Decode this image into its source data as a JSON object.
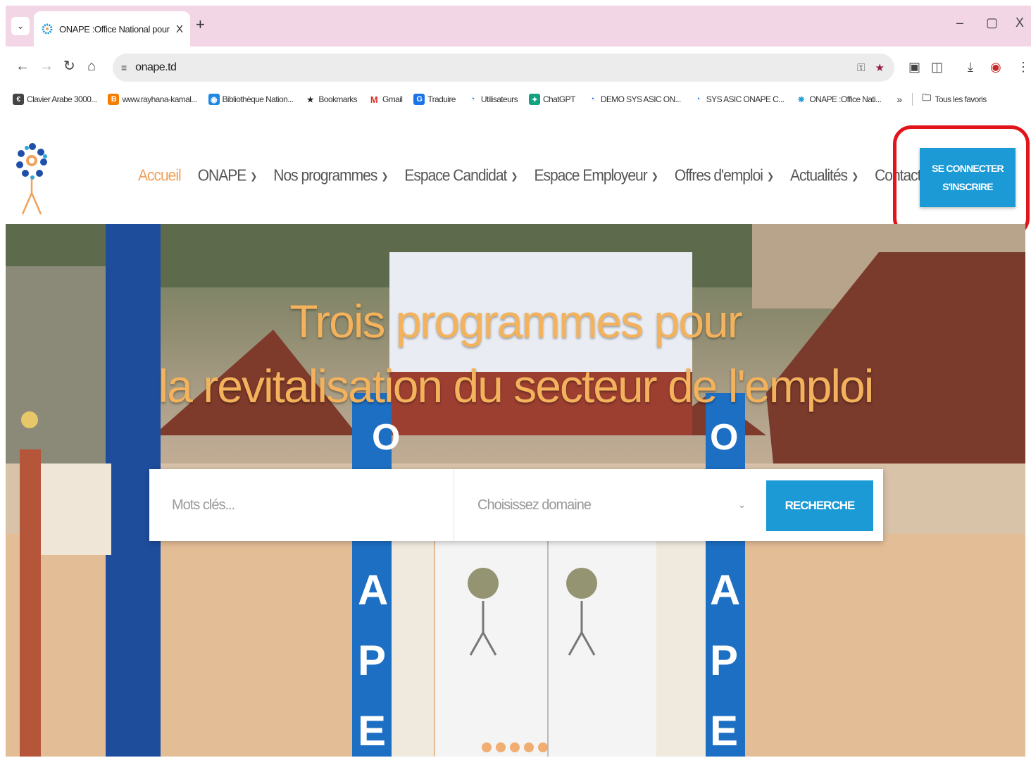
{
  "browser": {
    "tab": {
      "title": "ONAPE :Office National pour l",
      "close": "X"
    },
    "new_tab": "+",
    "window_controls": {
      "minimize": "–",
      "restore": "▢",
      "close": "X"
    },
    "address": {
      "url": "onape.td"
    },
    "bookmarks": [
      {
        "label": "Clavier Arabe 3000...",
        "icon": "keyboard-icon",
        "color": "#444444"
      },
      {
        "label": "www.rayhana-kamal...",
        "icon": "blogger-icon",
        "color": "#f57d00"
      },
      {
        "label": "Bibliothèque Nation...",
        "icon": "library-icon",
        "color": "#1e88e5"
      },
      {
        "label": "Bookmarks",
        "icon": "star-icon",
        "color": "#222222"
      },
      {
        "label": "Gmail",
        "icon": "gmail-icon",
        "color": "#d93025"
      },
      {
        "label": "Traduire",
        "icon": "translate-icon",
        "color": "#1a73e8"
      },
      {
        "label": "Utilisateurs",
        "icon": "globe-icon",
        "color": "#1a73e8"
      },
      {
        "label": "ChatGPT",
        "icon": "chatgpt-icon",
        "color": "#10a37f"
      },
      {
        "label": "DEMO SYS ASIC ON...",
        "icon": "globe-icon",
        "color": "#1a73e8"
      },
      {
        "label": "SYS ASIC ONAPE C...",
        "icon": "globe-icon",
        "color": "#1a73e8"
      },
      {
        "label": "ONAPE :Office Nati...",
        "icon": "onape-icon",
        "color": "#1b9ad6"
      }
    ],
    "bookmarks_more": "»",
    "all_bookmarks": "Tous les favoris"
  },
  "site": {
    "nav": [
      {
        "label": "Accueil",
        "dropdown": false,
        "active": true
      },
      {
        "label": "ONAPE",
        "dropdown": true
      },
      {
        "label": "Nos programmes",
        "dropdown": true
      },
      {
        "label": "Espace Candidat",
        "dropdown": true
      },
      {
        "label": "Espace Employeur",
        "dropdown": true
      },
      {
        "label": "Offres d'emploi",
        "dropdown": true
      },
      {
        "label": "Actualités",
        "dropdown": true
      },
      {
        "label": "Contact",
        "dropdown": false
      }
    ],
    "login_button": {
      "line1": "SE CONNECTER",
      "line2": "S'INSCRIRE"
    },
    "hero": {
      "title_line1": "Trois programmes pour",
      "title_line2": "la revitalisation du secteur de l'emploi"
    },
    "search": {
      "keywords_placeholder": "Mots clés...",
      "domain_placeholder": "Choisissez domaine",
      "button": "RECHERCHE"
    },
    "slider": {
      "count": 5
    }
  },
  "colors": {
    "accent": "#1b9ad6",
    "active_nav": "#f0a15b",
    "highlight": "#e1141c",
    "tabstrip": "#f3d6e6"
  }
}
